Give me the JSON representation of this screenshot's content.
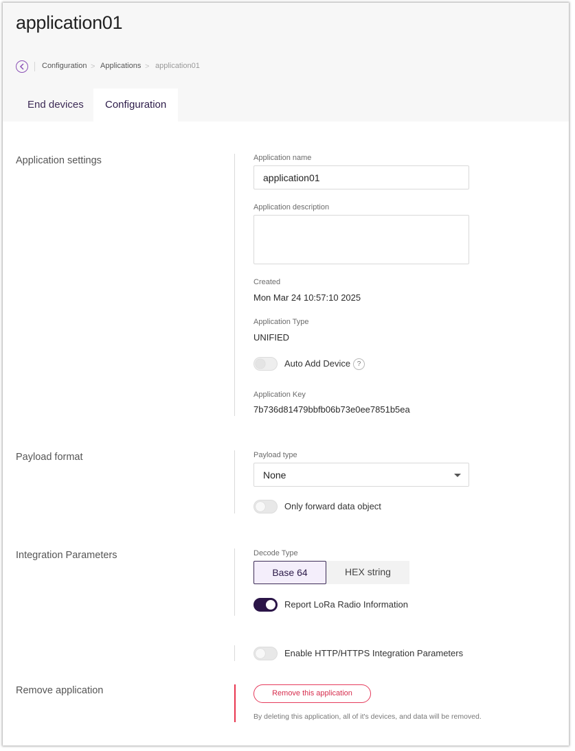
{
  "page": {
    "title": "application01"
  },
  "breadcrumb": {
    "items": [
      "Configuration",
      "Applications",
      "application01"
    ]
  },
  "tabs": [
    {
      "label": "End devices",
      "active": false
    },
    {
      "label": "Configuration",
      "active": true
    }
  ],
  "application_settings": {
    "section_label": "Application settings",
    "name_label": "Application name",
    "name_value": "application01",
    "description_label": "Application description",
    "description_value": "",
    "created_label": "Created",
    "created_value": "Mon Mar 24 10:57:10 2025",
    "type_label": "Application Type",
    "type_value": "UNIFIED",
    "auto_add_label": "Auto Add Device",
    "auto_add_enabled": false,
    "help_glyph": "?",
    "key_label": "Application Key",
    "key_value": "7b736d81479bbfb06b73e0ee7851b5ea"
  },
  "payload_format": {
    "section_label": "Payload format",
    "payload_type_label": "Payload type",
    "payload_type_value": "None",
    "only_forward_label": "Only forward data object",
    "only_forward_enabled": false
  },
  "integration_parameters": {
    "section_label": "Integration Parameters",
    "decode_type_label": "Decode Type",
    "decode_options": [
      "Base 64",
      "HEX string"
    ],
    "decode_selected": "Base 64",
    "report_lora_label": "Report LoRa Radio Information",
    "report_lora_enabled": true,
    "http_label": "Enable HTTP/HTTPS Integration Parameters",
    "http_enabled": false
  },
  "remove_application": {
    "section_label": "Remove application",
    "button_label": "Remove this application",
    "note": "By deleting this application, all of it's devices, and data will be removed."
  },
  "colors": {
    "accent": "#2b1548",
    "danger": "#e5395a",
    "header_bg": "#f7f7f7"
  }
}
